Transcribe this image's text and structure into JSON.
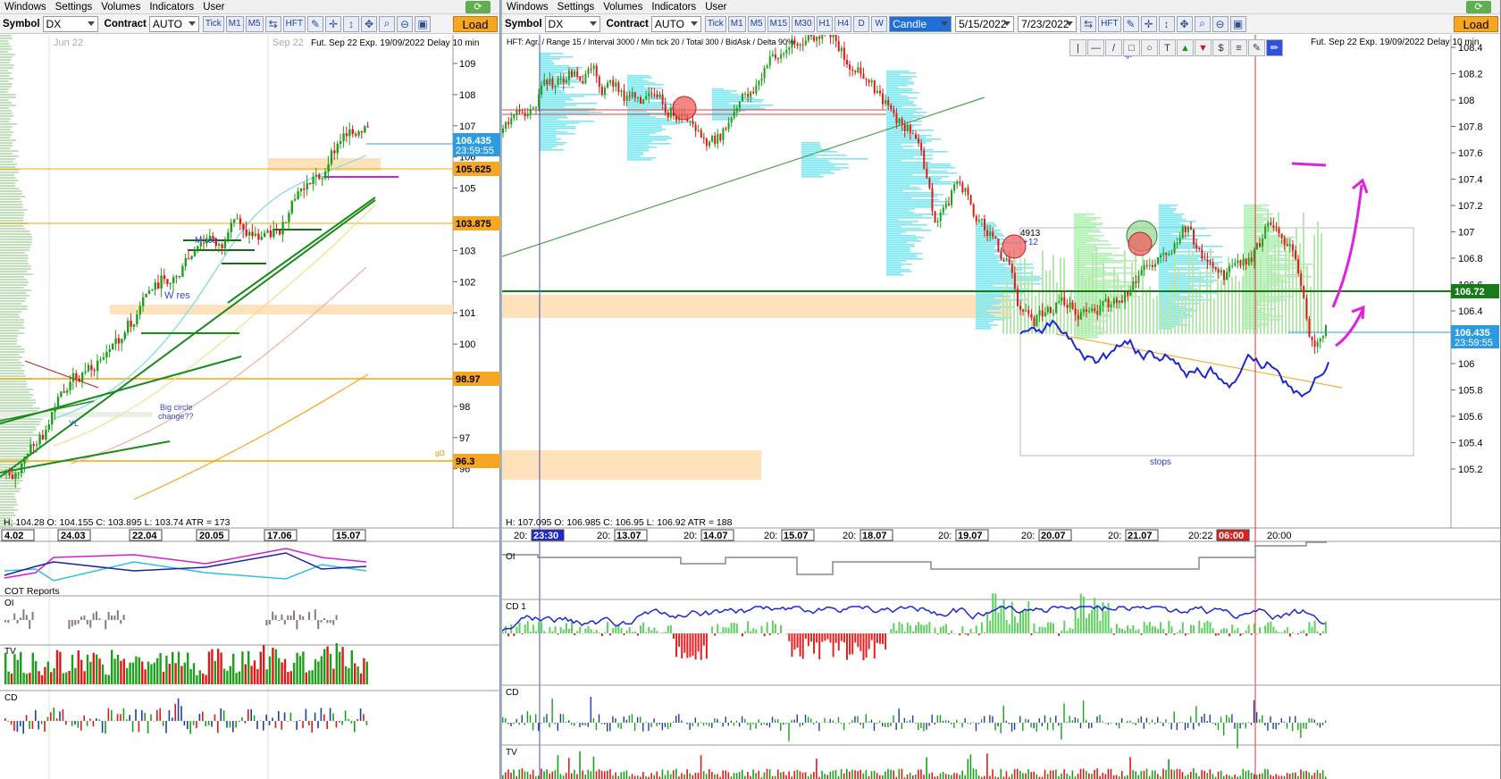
{
  "menu": [
    "Windows",
    "Settings",
    "Volumes",
    "Indicators",
    "User"
  ],
  "left": {
    "symbol_label": "Symbol",
    "symbol": "DX",
    "contract_label": "Contract",
    "contract": "AUTO",
    "tf_buttons": [
      "Tick",
      "M1",
      "M5"
    ],
    "tool_labels": {
      "hft": "HFT"
    },
    "load": "Load",
    "header": "Fut. Sep 22 Exp. 19/09/2022 Delay 10 min",
    "top_dates": [
      "Jun 22",
      "Sep 22"
    ],
    "price_ticks": [
      "109",
      "108",
      "107",
      "106",
      "105",
      "104",
      "103",
      "102",
      "101",
      "100",
      "99",
      "98",
      "97",
      "96"
    ],
    "price_tags": [
      {
        "text": "106.435",
        "sub": "23:59:55",
        "color": "#2e9be0"
      },
      {
        "text": "105.625",
        "color": "#f5a623"
      },
      {
        "text": "103.875",
        "color": "#f5a623"
      },
      {
        "text": "98.97",
        "color": "#f5a623"
      },
      {
        "text": "96.3",
        "color": "#f5a623"
      }
    ],
    "annotations": {
      "w_res": "W res",
      "m_res": "M res",
      "big_circle": "Big circle",
      "change": "change??",
      "yl": "YL",
      "gl3": "gl3"
    },
    "ohlc": "H: 104.28   O: 104.155   C: 103.895   L: 103.74   ATR = 173",
    "date_labels": [
      "4.02",
      "24.03",
      "22.04",
      "20.05",
      "17.06",
      "15.07"
    ],
    "sub_panels": [
      "COT Reports",
      "OI",
      "TV",
      "CD"
    ]
  },
  "right": {
    "symbol_label": "Symbol",
    "symbol": "DX",
    "contract_label": "Contract",
    "contract": "AUTO",
    "tf_buttons": [
      "Tick",
      "M1",
      "M5",
      "M15",
      "M30",
      "H1",
      "H4",
      "D",
      "W"
    ],
    "chart_type": "Candle",
    "date_from": "5/15/2022",
    "date_to": "7/23/2022",
    "tool_labels": {
      "hft": "HFT"
    },
    "load": "Load",
    "header_left": "HFT: Agr. / Range 15 / Interval 3000 / Min tick 20 / Total 300 / BidAsk / Delta 90%",
    "header_right": "Fut. Sep 22 Exp. 19/09/2022 Delay 10 min",
    "price_ticks": [
      "108.4",
      "108.2",
      "108",
      "107.8",
      "107.6",
      "107.4",
      "107.2",
      "107",
      "106.8",
      "106.6",
      "106.4",
      "106.2",
      "106",
      "105.8",
      "105.6",
      "105.4",
      "105.2"
    ],
    "price_tags": [
      {
        "text": "106.72",
        "color": "#1a7a1a"
      },
      {
        "text": "106.435",
        "sub": "23:59:55",
        "color": "#2e9be0"
      }
    ],
    "annotations": {
      "vol": "4913",
      "delta": "+12",
      "stops": "stops",
      "lgt": "lgt"
    },
    "ohlc": "H: 107.095   O: 106.985   C: 106.95   L: 106.92   ATR = 188",
    "date_labels": [
      {
        "pre": "20:",
        "box": "23:30"
      },
      {
        "pre": "20:",
        "box": "13.07"
      },
      {
        "pre": "20:",
        "box": "14.07"
      },
      {
        "pre": "20:",
        "box": "15.07"
      },
      {
        "pre": "20:",
        "box": "18.07"
      },
      {
        "pre": "20:",
        "box": "19.07"
      },
      {
        "pre": "20:",
        "box": "20.07"
      },
      {
        "pre": "20:",
        "box": "21.07"
      },
      {
        "pre": "20:22",
        "box": "06:00"
      },
      {
        "pre": "20:00",
        "box": ""
      }
    ],
    "sub_panels": [
      "OI",
      "CD 1",
      "CD",
      "TV"
    ],
    "draw_tools": [
      "|",
      "—",
      "/",
      "□",
      "○",
      "T",
      "▲",
      "▼",
      "$",
      "≡",
      "✎",
      "✏"
    ]
  }
}
